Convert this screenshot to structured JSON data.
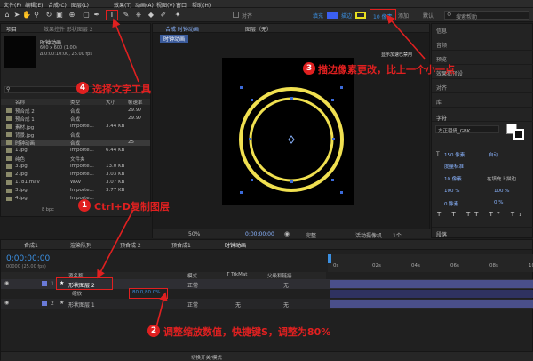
{
  "menu": [
    "文件(F)",
    "编辑(E)",
    "合成(C)",
    "图层(L)",
    "效果(T)",
    "动画(A)",
    "视图(V)",
    "窗口",
    "帮助(H)"
  ],
  "toolbar": {
    "snap_label": "对齐",
    "fill_label": "填充",
    "stroke_label": "描边",
    "stroke_value": "10 像素",
    "add_label": "添加",
    "default_label": "默认",
    "search_placeholder": "搜索帮助"
  },
  "project": {
    "tab_project": "项目",
    "tab_effects": "效果控件 形状图层 2",
    "comp_name": "时钟动画",
    "comp_info1": "600 x 600 (1.00)",
    "comp_info2": "Δ 0:00:10:00, 25.00 fps",
    "columns": [
      "名称",
      "类型",
      "大小",
      "帧速率"
    ],
    "items": [
      {
        "name": "预合成 2",
        "type": "合成",
        "size": "",
        "fps": "29.97"
      },
      {
        "name": "预合成 1",
        "type": "合成",
        "size": "",
        "fps": "29.97"
      },
      {
        "name": "素材.jpg",
        "type": "Importe...",
        "size": "3.44 KB",
        "fps": ""
      },
      {
        "name": "背景.jpg",
        "type": "合成",
        "size": "",
        "fps": ""
      },
      {
        "name": "时钟动画",
        "type": "合成",
        "size": "",
        "fps": "25"
      },
      {
        "name": "1.jpg",
        "type": "Importe...",
        "size": "6.44 KB",
        "fps": ""
      },
      {
        "name": "纯色",
        "type": "文件夹",
        "size": "",
        "fps": ""
      },
      {
        "name": "3.jpg",
        "type": "Importe...",
        "size": "13.0 KB",
        "fps": ""
      },
      {
        "name": "2.jpg",
        "type": "Importe...",
        "size": "3.03 KB",
        "fps": ""
      },
      {
        "name": "1781.mav",
        "type": "WAV",
        "size": "3.07 KB",
        "fps": ""
      },
      {
        "name": "3.jpg",
        "type": "Importe...",
        "size": "3.77 KB",
        "fps": ""
      },
      {
        "name": "4.jpg",
        "type": "Importe...",
        "size": "",
        "fps": ""
      }
    ],
    "bpc": "8 bpc"
  },
  "comp": {
    "tab_comp": "合成 时钟动画",
    "tab_layer": "图层（无）",
    "subtab": "时钟动画",
    "gpu_note": "显示加速已禁用",
    "zoom": "50%",
    "timecode": "0:00:00:00",
    "quality": "完整",
    "camera": "活动摄像机",
    "view": "1个..."
  },
  "right_panel": {
    "items": [
      "信息",
      "音频",
      "预览",
      "效果和预设",
      "对齐",
      "库"
    ],
    "char_title": "字符",
    "font_name": "方正粗倩_GBK",
    "font_size": "150 像素",
    "leading": "自动",
    "kerning": "度量标准",
    "stroke_width": "10 像素",
    "stroke_mode": "在填充上描边",
    "scale_v": "100 %",
    "scale_h": "100 %",
    "baseline": "0 像素",
    "tsume": "0 %",
    "paragraph": "段落"
  },
  "timeline": {
    "tabs": [
      "合成1",
      "渲染队列",
      "预合成 2",
      "预合成1",
      "时钟动画"
    ],
    "timecode": "0:00:00:00",
    "fps_note": "00000 (25.00 fps)",
    "col_source": "源名称",
    "col_mode": "模式",
    "col_trkmat": "T TrkMat",
    "col_parent": "父级和链接",
    "ruler": [
      "0s",
      "02s",
      "04s",
      "06s",
      "08s",
      "10s"
    ],
    "layers": [
      {
        "index": "1",
        "name": "形状图层 2",
        "mode": "正常",
        "parent": "无"
      },
      {
        "index": "2",
        "name": "形状图层 1",
        "mode": "正常",
        "trkmat": "无",
        "parent": "无"
      }
    ],
    "prop_label": "缩放",
    "scale_value": "80.0,80.0%",
    "bottom_label": "切换开关/模式"
  },
  "annotations": {
    "a1_num": "1",
    "a1_text": "Ctrl+D复制图层",
    "a2_num": "2",
    "a2_text": "调整缩放数值，快捷键S，调整为80%",
    "a3_num": "3",
    "a3_text": "描边像素更改，比上一个小一点",
    "a4_num": "4",
    "a4_text": "选择文字工具"
  },
  "colors": {
    "accent_blue": "#3b78d8",
    "annotation_red": "#e02020",
    "ring_yellow": "#f0e050",
    "layer_bar": "#4a4f8a"
  }
}
